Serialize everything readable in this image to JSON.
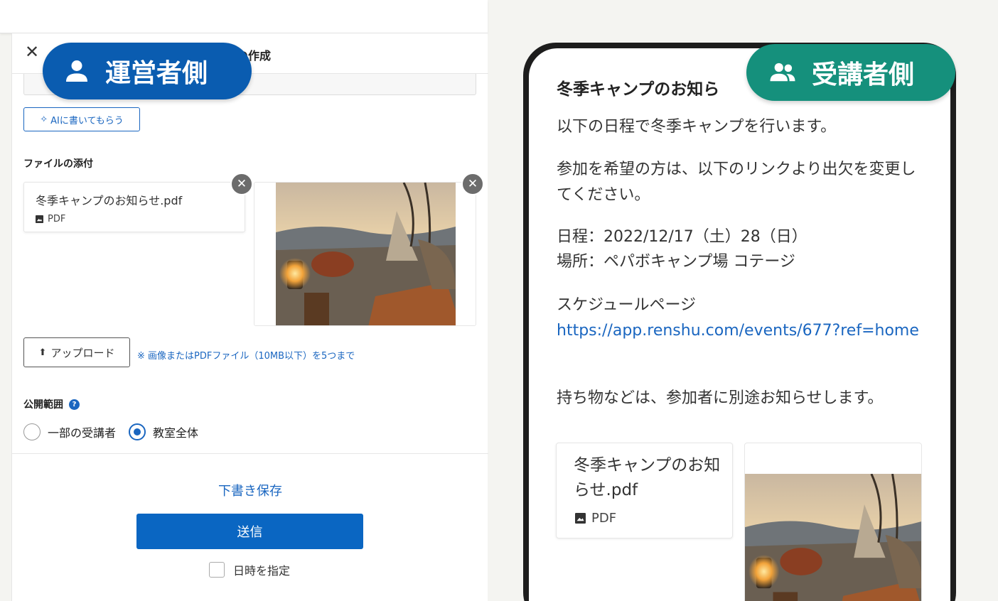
{
  "operator_badge": {
    "label": "運営者側",
    "icon": "person-icon",
    "color": "#0a5cb0"
  },
  "student_badge": {
    "label": "受講者側",
    "icon": "group-icon",
    "color": "#15907c"
  },
  "admin": {
    "title_partial": "せの作成",
    "ai_button": "AIに書いてもらう",
    "attachments_label": "ファイルの添付",
    "file": {
      "name": "冬季キャンプのお知らせ.pdf",
      "type": "PDF"
    },
    "upload_button": "アップロード",
    "upload_note": "※ 画像またはPDFファイル（10MB以下）を5つまで",
    "visibility_label": "公開範囲",
    "visibility_options": [
      {
        "label": "一部の受講者",
        "selected": false
      },
      {
        "label": "教室全体",
        "selected": true
      }
    ],
    "draft_button": "下書き保存",
    "send_button": "送信",
    "schedule_label": "日時を指定"
  },
  "student": {
    "title": "冬季キャンプのお知ら",
    "para1": "以下の日程で冬季キャンプを行います。",
    "para2": " 参加を希望の方は、以下のリンクより出欠を変更してください。",
    "date_line": "日程：2022/12/17（土）28（日）",
    "place_line": "場所：ペパボキャンプ場 コテージ",
    "schedule_page_label": "スケジュールページ",
    "schedule_link": "https://app.renshu.com/events/677?ref=home",
    "para4": "持ち物などは、参加者に別途お知らせします。",
    "file": {
      "name": "冬季キャンプのお知らせ.pdf",
      "type": "PDF"
    }
  },
  "colors": {
    "accent": "#0a66c2",
    "link": "#1a66c0",
    "background": "#f4f4f1"
  }
}
